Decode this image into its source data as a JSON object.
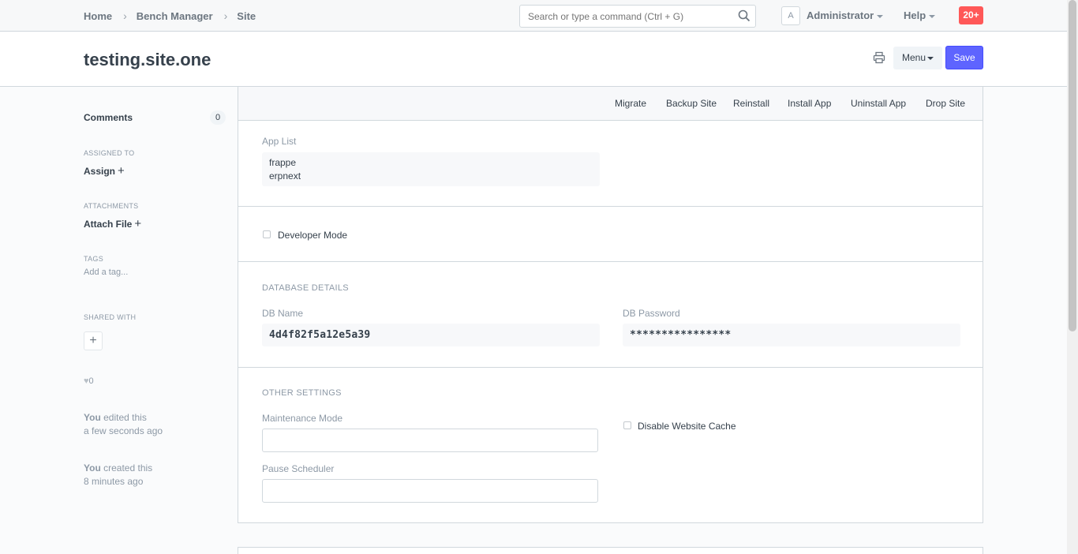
{
  "navbar": {
    "breadcrumbs": [
      "Home",
      "Bench Manager",
      "Site"
    ],
    "search_placeholder": "Search or type a command (Ctrl + G)",
    "avatar_initial": "A",
    "user": "Administrator",
    "help": "Help",
    "notifications": "20+"
  },
  "page": {
    "title": "testing.site.one",
    "menu_label": "Menu",
    "save_label": "Save"
  },
  "sidebar": {
    "comments_label": "Comments",
    "comments_count": "0",
    "assigned_to_heading": "ASSIGNED TO",
    "assign_label": "Assign",
    "attachments_heading": "ATTACHMENTS",
    "attach_label": "Attach File",
    "tags_heading": "TAGS",
    "add_tag": "Add a tag...",
    "shared_with_heading": "SHARED WITH",
    "likes": "0",
    "activity": [
      {
        "who": "You",
        "what": "edited this",
        "when": "a few seconds ago"
      },
      {
        "who": "You",
        "what": "created this",
        "when": "8 minutes ago"
      }
    ]
  },
  "actions": [
    "Migrate",
    "Backup Site",
    "Reinstall",
    "Install App",
    "Uninstall App",
    "Drop Site"
  ],
  "form": {
    "app_list_label": "App List",
    "apps": [
      "frappe",
      "erpnext"
    ],
    "developer_mode_label": "Developer Mode",
    "developer_mode": false,
    "database_heading": "DATABASE DETAILS",
    "db_name_label": "DB Name",
    "db_name": "4d4f82f5a12e5a39",
    "db_password_label": "DB Password",
    "db_password": "****************",
    "other_heading": "OTHER SETTINGS",
    "maintenance_label": "Maintenance Mode",
    "maintenance_value": "",
    "pause_scheduler_label": "Pause Scheduler",
    "pause_scheduler_value": "",
    "disable_cache_label": "Disable Website Cache",
    "disable_cache": false
  },
  "colors": {
    "primary": "#5e64ff",
    "notification": "#ff5858",
    "text": "#36414c",
    "muted": "#8d99a6",
    "border": "#d1d8dd"
  }
}
